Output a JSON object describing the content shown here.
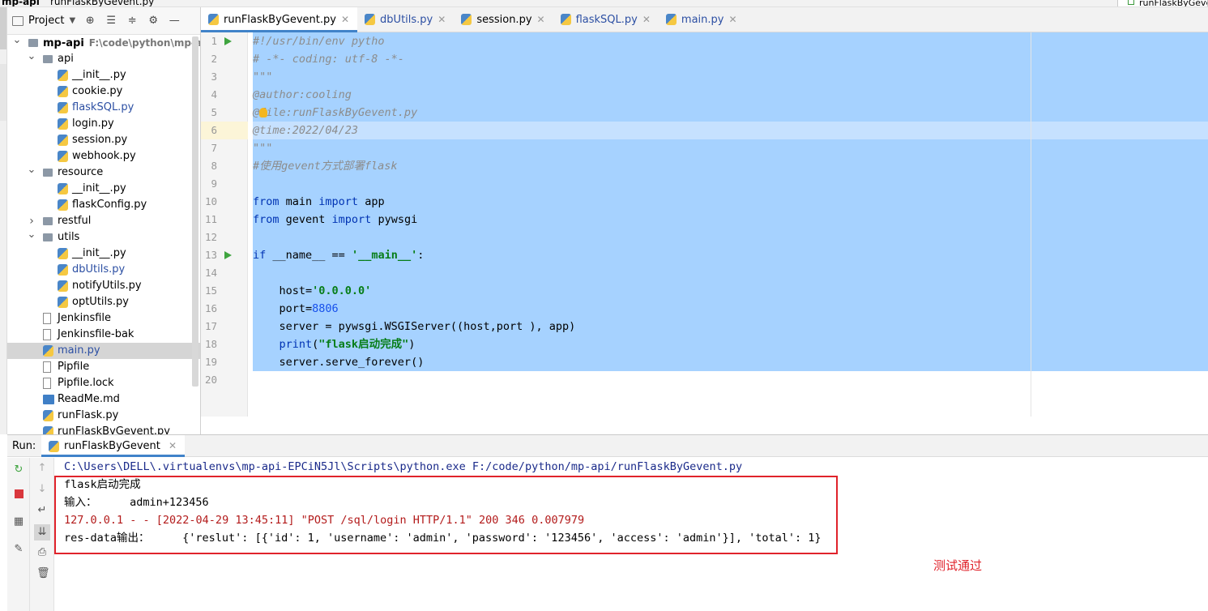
{
  "window": {
    "breadcrumb_project": "mp-api",
    "breadcrumb_file": "runFlaskByGevent.py",
    "run_config": "runFlaskByGevent"
  },
  "project_panel": {
    "title": "Project",
    "tree": [
      {
        "label": "mp-api",
        "path": "F:\\code\\python\\mp-ap",
        "type": "folder",
        "depth": 0,
        "expanded": true,
        "bold": true
      },
      {
        "label": "api",
        "type": "folder",
        "depth": 1,
        "expanded": true
      },
      {
        "label": "__init__.py",
        "type": "py",
        "depth": 2
      },
      {
        "label": "cookie.py",
        "type": "py",
        "depth": 2
      },
      {
        "label": "flaskSQL.py",
        "type": "py",
        "depth": 2,
        "blue": true
      },
      {
        "label": "login.py",
        "type": "py",
        "depth": 2
      },
      {
        "label": "session.py",
        "type": "py",
        "depth": 2
      },
      {
        "label": "webhook.py",
        "type": "py",
        "depth": 2
      },
      {
        "label": "resource",
        "type": "folder",
        "depth": 1,
        "expanded": true
      },
      {
        "label": "__init__.py",
        "type": "py",
        "depth": 2
      },
      {
        "label": "flaskConfig.py",
        "type": "py",
        "depth": 2
      },
      {
        "label": "restful",
        "type": "folder",
        "depth": 1,
        "expanded": false
      },
      {
        "label": "utils",
        "type": "folder",
        "depth": 1,
        "expanded": true
      },
      {
        "label": "__init__.py",
        "type": "py",
        "depth": 2
      },
      {
        "label": "dbUtils.py",
        "type": "py",
        "depth": 2,
        "blue": true
      },
      {
        "label": "notifyUtils.py",
        "type": "py",
        "depth": 2
      },
      {
        "label": "optUtils.py",
        "type": "py",
        "depth": 2
      },
      {
        "label": "Jenkinsfile",
        "type": "txt",
        "depth": 1
      },
      {
        "label": "Jenkinsfile-bak",
        "type": "txt",
        "depth": 1
      },
      {
        "label": "main.py",
        "type": "py",
        "depth": 1,
        "blue": true,
        "selected": true
      },
      {
        "label": "Pipfile",
        "type": "txt",
        "depth": 1
      },
      {
        "label": "Pipfile.lock",
        "type": "txt",
        "depth": 1
      },
      {
        "label": "ReadMe.md",
        "type": "md",
        "depth": 1
      },
      {
        "label": "runFlask.py",
        "type": "py",
        "depth": 1
      },
      {
        "label": "runFlaskByGevent.py",
        "type": "py",
        "depth": 1
      }
    ]
  },
  "editor_tabs": [
    {
      "label": "runFlaskByGevent.py",
      "active": true
    },
    {
      "label": "dbUtils.py",
      "blue": true
    },
    {
      "label": "session.py"
    },
    {
      "label": "flaskSQL.py",
      "blue": true
    },
    {
      "label": "main.py",
      "blue": true
    }
  ],
  "code_lines": [
    {
      "n": "1",
      "run": true,
      "segs": [
        {
          "t": "#!/usr/bin/env pytho",
          "c": "c-com"
        }
      ]
    },
    {
      "n": "2",
      "segs": [
        {
          "t": "# -*- coding: utf-8 -*-",
          "c": "c-com"
        }
      ]
    },
    {
      "n": "3",
      "segs": [
        {
          "t": "\"\"\"",
          "c": "c-doc"
        }
      ]
    },
    {
      "n": "4",
      "segs": [
        {
          "t": "@author:cooling",
          "c": "c-doc"
        }
      ]
    },
    {
      "n": "5",
      "bulb": true,
      "segs": [
        {
          "t": "@file:runFlaskByGevent.py",
          "c": "c-doc"
        }
      ]
    },
    {
      "n": "6",
      "current": true,
      "segs": [
        {
          "t": "@time:2022/04/23",
          "c": "c-doc"
        }
      ]
    },
    {
      "n": "7",
      "segs": [
        {
          "t": "\"\"\"",
          "c": "c-doc"
        }
      ]
    },
    {
      "n": "8",
      "segs": [
        {
          "t": "#使用gevent方式部署flask",
          "c": "c-com"
        }
      ]
    },
    {
      "n": "9",
      "segs": []
    },
    {
      "n": "10",
      "segs": [
        {
          "t": "from",
          "c": "c-kw"
        },
        {
          "t": " main ",
          "c": ""
        },
        {
          "t": "import",
          "c": "c-kw"
        },
        {
          "t": " app",
          "c": ""
        }
      ]
    },
    {
      "n": "11",
      "segs": [
        {
          "t": "from",
          "c": "c-kw"
        },
        {
          "t": " gevent ",
          "c": ""
        },
        {
          "t": "import",
          "c": "c-kw"
        },
        {
          "t": " pywsgi",
          "c": ""
        }
      ]
    },
    {
      "n": "12",
      "segs": []
    },
    {
      "n": "13",
      "run": true,
      "segs": [
        {
          "t": "if",
          "c": "c-kw"
        },
        {
          "t": " __name__ == ",
          "c": ""
        },
        {
          "t": "'__main__'",
          "c": "c-strb"
        },
        {
          "t": ":",
          "c": ""
        }
      ]
    },
    {
      "n": "14",
      "segs": []
    },
    {
      "n": "15",
      "segs": [
        {
          "t": "    host=",
          "c": ""
        },
        {
          "t": "'0.0.0.0'",
          "c": "c-strb"
        }
      ]
    },
    {
      "n": "16",
      "segs": [
        {
          "t": "    port=",
          "c": ""
        },
        {
          "t": "8806",
          "c": "c-num"
        }
      ]
    },
    {
      "n": "17",
      "segs": [
        {
          "t": "    server = pywsgi.WSGIServer((host,port ), app)",
          "c": ""
        }
      ]
    },
    {
      "n": "18",
      "segs": [
        {
          "t": "    ",
          "c": ""
        },
        {
          "t": "print",
          "c": "c-kw"
        },
        {
          "t": "(",
          "c": ""
        },
        {
          "t": "\"flask启动完成\"",
          "c": "c-strb"
        },
        {
          "t": ")",
          "c": ""
        }
      ]
    },
    {
      "n": "19",
      "segs": [
        {
          "t": "    server.serve_forever()",
          "c": ""
        }
      ]
    },
    {
      "n": "20",
      "segs": []
    }
  ],
  "run_panel": {
    "label": "Run:",
    "tab": "runFlaskByGevent",
    "console": [
      {
        "text": "C:\\Users\\DELL\\.virtualenvs\\mp-api-EPCiN5Jl\\Scripts\\python.exe F:/code/python/mp-api/runFlaskByGevent.py",
        "kind": "cmd"
      },
      {
        "text": "flask启动完成",
        "kind": "out"
      },
      {
        "text": "输入：     admin+123456",
        "kind": "out"
      },
      {
        "text": "127.0.0.1 - - [2022-04-29 13:45:11] \"POST /sql/login HTTP/1.1\" 200 346 0.007979",
        "kind": "err"
      },
      {
        "text": "res-data输出：     {'reslut': [{'id': 1, 'username': 'admin', 'password': '123456', 'access': 'admin'}], 'total': 1}",
        "kind": "out"
      }
    ],
    "annotation": "测试通过"
  },
  "colors": {
    "selection": "#a6d2ff",
    "keyword": "#0033b3",
    "string": "#067d17",
    "number": "#1750eb",
    "comment": "#8c8c8c",
    "annotation_red": "#e0232b",
    "tab_underline": "#4083c9"
  }
}
